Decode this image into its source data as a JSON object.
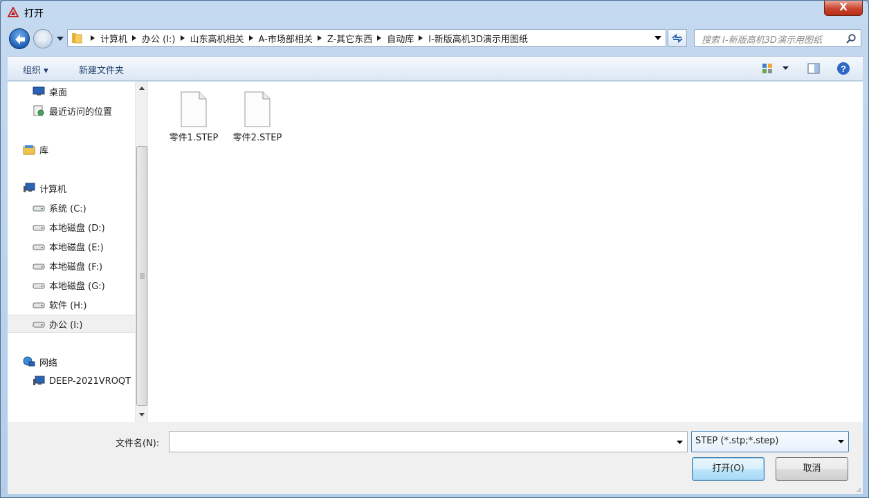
{
  "window": {
    "title": "打开",
    "close_label": "X"
  },
  "address": {
    "crumbs": [
      "计算机",
      "办公 (I:)",
      "山东高机相关",
      "A-市场部相关",
      "Z-其它东西",
      "自动库",
      "I-新版高机3D演示用图纸"
    ]
  },
  "search": {
    "placeholder": "搜索 I-新版高机3D演示用图纸"
  },
  "toolbar": {
    "organize_label": "组织 ▾",
    "new_folder_label": "新建文件夹"
  },
  "nav": {
    "items": [
      {
        "label": "桌面",
        "icon": "desktop-icon"
      },
      {
        "label": "最近访问的位置",
        "icon": "recent-places-icon"
      },
      {
        "label": "库",
        "icon": "library-icon"
      },
      {
        "label": "计算机",
        "icon": "computer-icon"
      },
      {
        "label": "系统 (C:)",
        "icon": "drive-icon"
      },
      {
        "label": "本地磁盘 (D:)",
        "icon": "drive-icon"
      },
      {
        "label": "本地磁盘 (E:)",
        "icon": "drive-icon"
      },
      {
        "label": "本地磁盘 (F:)",
        "icon": "drive-icon"
      },
      {
        "label": "本地磁盘 (G:)",
        "icon": "drive-icon"
      },
      {
        "label": "软件 (H:)",
        "icon": "drive-icon"
      },
      {
        "label": "办公 (I:)",
        "icon": "drive-icon",
        "selected": true
      },
      {
        "label": "网络",
        "icon": "network-icon"
      },
      {
        "label": "DEEP-2021VROQT",
        "icon": "computer-icon"
      }
    ]
  },
  "files": [
    {
      "name": "零件1.STEP",
      "icon": "document-icon"
    },
    {
      "name": "零件2.STEP",
      "icon": "document-icon"
    }
  ],
  "bottom": {
    "filename_label": "文件名(N):",
    "filename_value": "",
    "filetype_value": "STEP (*.stp;*.step)",
    "open_label": "打开(O)",
    "cancel_label": "取消"
  },
  "colors": {
    "accent": "#3c7fb1",
    "close": "#c9452d",
    "selection": "#f0f0f0"
  }
}
